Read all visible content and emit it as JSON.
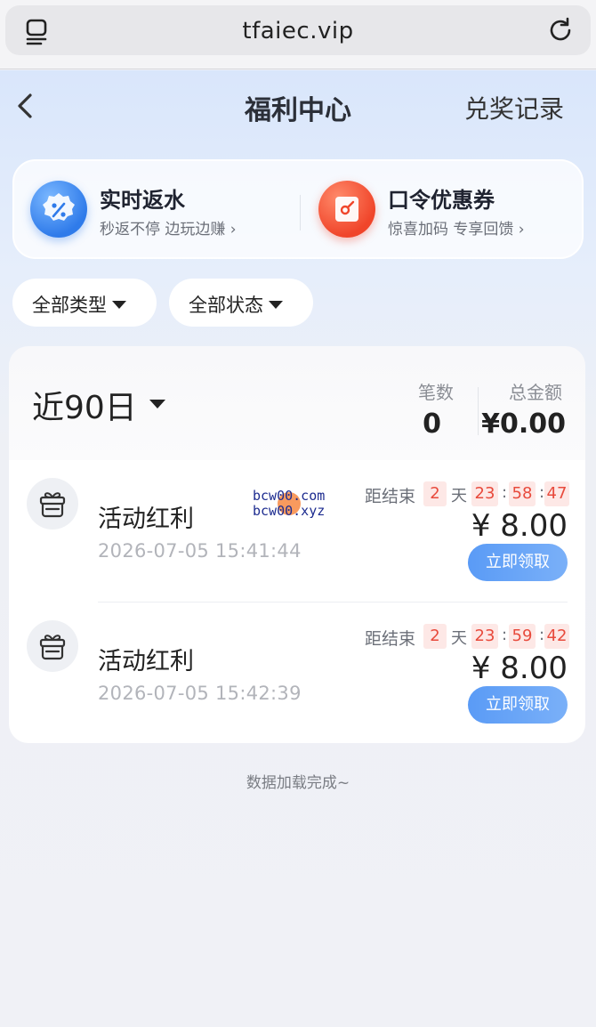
{
  "browser": {
    "url": "tfaiec.vip",
    "tabs_icon": "tabs-icon",
    "reload_icon": "reload-icon"
  },
  "nav": {
    "back_icon": "chevron-left-icon",
    "title": "福利中心",
    "right_link": "兑奖记录"
  },
  "promo": [
    {
      "title": "实时返水",
      "subtitle": "秒返不停 边玩边赚 ›",
      "icon": "percent-badge-icon",
      "color": "#2f7bea"
    },
    {
      "title": "口令优惠券",
      "subtitle": "惊喜加码 专享回馈 ›",
      "icon": "coupon-icon",
      "color": "#f0452a"
    }
  ],
  "filters": [
    {
      "label": "全部类型"
    },
    {
      "label": "全部状态"
    }
  ],
  "summary": {
    "period": "近90日",
    "count_label": "笔数",
    "count_value": "0",
    "total_label": "总金额",
    "total_value": "¥0.00"
  },
  "watermark": {
    "line1": "bcw00.com",
    "line2": "bcw00.xyz"
  },
  "records": [
    {
      "name": "活动红利",
      "time": "2026-07-05 15:41:44",
      "countdown_label": "距结束",
      "days": "2",
      "day_unit": "天",
      "hours": "23",
      "minutes": "58",
      "seconds": "47",
      "amount": "¥ 8.00",
      "button": "立即领取"
    },
    {
      "name": "活动红利",
      "time": "2026-07-05 15:42:39",
      "countdown_label": "距结束",
      "days": "2",
      "day_unit": "天",
      "hours": "23",
      "minutes": "59",
      "seconds": "42",
      "amount": "¥ 8.00",
      "button": "立即领取"
    }
  ],
  "footer": "数据加载完成~",
  "colors": {
    "accent": "#5a9bf6",
    "countdown_bg": "#fde8e6",
    "countdown_text": "#e84a3c"
  }
}
